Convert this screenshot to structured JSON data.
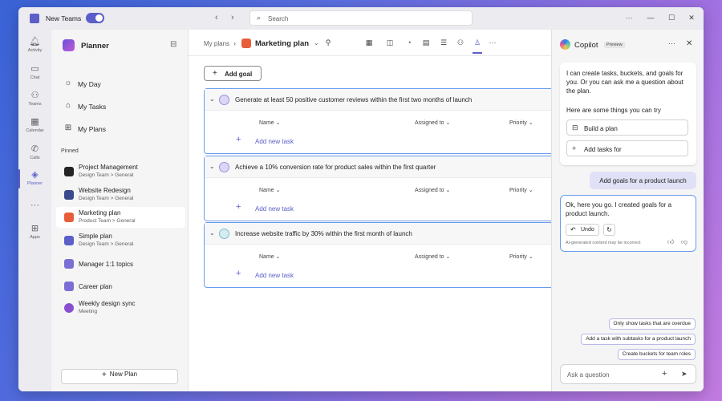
{
  "titlebar": {
    "app_title": "New Teams",
    "search_placeholder": "Search"
  },
  "rail": [
    {
      "label": "Activity",
      "icon": "bell-icon"
    },
    {
      "label": "Chat",
      "icon": "chat-icon"
    },
    {
      "label": "Teams",
      "icon": "teams-icon"
    },
    {
      "label": "Calendar",
      "icon": "calendar-icon"
    },
    {
      "label": "Calls",
      "icon": "phone-icon"
    },
    {
      "label": "Planner",
      "icon": "planner-icon",
      "active": true
    },
    {
      "label": "",
      "icon": "more-icon"
    },
    {
      "label": "Apps",
      "icon": "apps-icon"
    }
  ],
  "sidebar": {
    "title": "Planner",
    "nav": [
      {
        "label": "My Day",
        "icon": "sun-icon"
      },
      {
        "label": "My Tasks",
        "icon": "home-icon"
      },
      {
        "label": "My Plans",
        "icon": "grid-icon"
      }
    ],
    "pinned_heading": "Pinned",
    "pinned": [
      {
        "name": "Project Management",
        "sub": "Design Team > General",
        "color": "#242424"
      },
      {
        "name": "Website Redesign",
        "sub": "Design Team > General",
        "color": "#3a4a8c"
      },
      {
        "name": "Marketing plan",
        "sub": "Product Team > General",
        "color": "#e85d3a",
        "selected": true
      },
      {
        "name": "Simple plan",
        "sub": "Design Team > General",
        "color": "#5b5fc7"
      },
      {
        "name": "Manager 1:1 topics",
        "sub": "",
        "color": "#7b6fd6"
      },
      {
        "name": "Career plan",
        "sub": "",
        "color": "#7b6fd6"
      },
      {
        "name": "Weekly design sync",
        "sub": "Meeting",
        "color": "#8a4fd0"
      }
    ],
    "new_plan": "New Plan"
  },
  "main": {
    "breadcrumb": "My plans",
    "plan_title": "Marketing plan",
    "add_goal": "Add goal",
    "columns": {
      "name": "Name",
      "assigned": "Assigned to",
      "priority": "Priority"
    },
    "add_task": "Add new task",
    "goals": [
      {
        "title": "Generate at least 50 positive customer reviews within the first two months of launch"
      },
      {
        "title": "Achieve a 10% conversion rate for product sales within the first quarter"
      },
      {
        "title": "Increase website traffic by 30% within the first month of launch"
      }
    ]
  },
  "copilot": {
    "title": "Copilot",
    "badge": "Preview",
    "intro": "I can create tasks, buckets, and goals for you. Or you can ask me a question about the plan.",
    "try_label": "Here are some things you can try",
    "suggestions": [
      {
        "label": "Build a plan"
      },
      {
        "label": "Add tasks for"
      }
    ],
    "user_message": "Add goals for a product launch",
    "response": "Ok, here you go. I created goals for a product launch.",
    "undo": "Undo",
    "disclaimer": "AI-generated content may be incorrect",
    "prompts": [
      "Only show tasks that are overdue",
      "Add a task with subtasks for a product launch",
      "Create buckets for team roles"
    ],
    "ask_placeholder": "Ask a question"
  },
  "colors": {
    "accent": "#5b5fc7",
    "goal_border": "#6b9bf0",
    "plan_icon": "#e85d3a"
  }
}
